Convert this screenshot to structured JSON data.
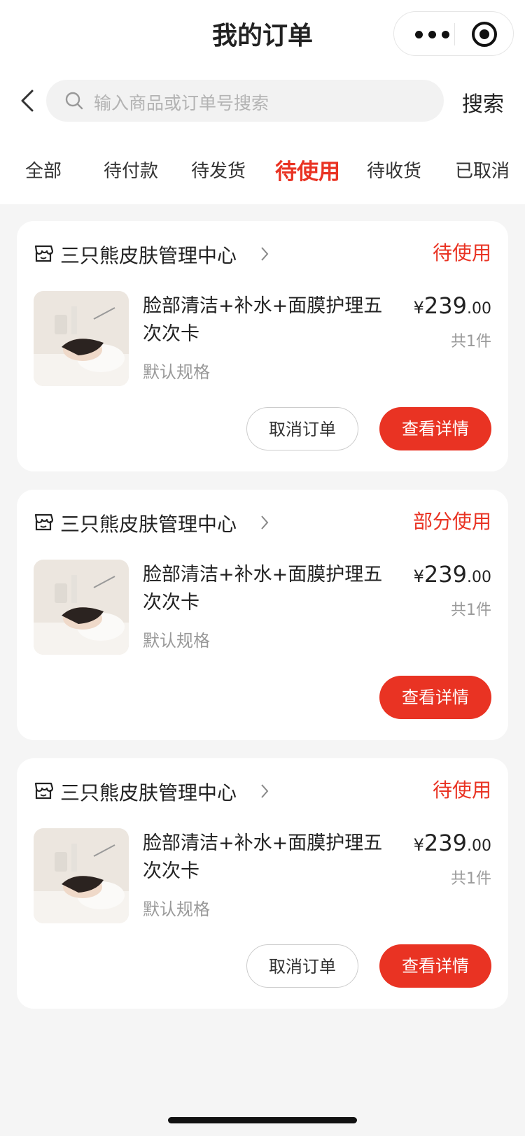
{
  "header": {
    "title": "我的订单",
    "capsule": {
      "more_icon": "more-dots-icon",
      "close_icon": "target-close-icon"
    }
  },
  "search": {
    "placeholder": "输入商品或订单号搜索",
    "button": "搜索"
  },
  "tabs": [
    {
      "label": "全部",
      "active": false
    },
    {
      "label": "待付款",
      "active": false
    },
    {
      "label": "待发货",
      "active": false
    },
    {
      "label": "待使用",
      "active": true
    },
    {
      "label": "待收货",
      "active": false
    },
    {
      "label": "已取消",
      "active": false
    }
  ],
  "colors": {
    "accent": "#e93323",
    "bg": "#f5f5f5"
  },
  "orders": [
    {
      "shop": "三只熊皮肤管理中心",
      "status": "待使用",
      "product": "脸部清洁+补水+面膜护理五次次卡",
      "spec": "默认规格",
      "price_currency": "¥",
      "price_int": "239",
      "price_dec": ".00",
      "qty": "共1件",
      "cancel_label": "取消订单",
      "detail_label": "查看详情"
    },
    {
      "shop": "三只熊皮肤管理中心",
      "status": "部分使用",
      "product": "脸部清洁+补水+面膜护理五次次卡",
      "spec": "默认规格",
      "price_currency": "¥",
      "price_int": "239",
      "price_dec": ".00",
      "qty": "共1件",
      "detail_label": "查看详情"
    },
    {
      "shop": "三只熊皮肤管理中心",
      "status": "待使用",
      "product": "脸部清洁+补水+面膜护理五次次卡",
      "spec": "默认规格",
      "price_currency": "¥",
      "price_int": "239",
      "price_dec": ".00",
      "qty": "共1件",
      "cancel_label": "取消订单",
      "detail_label": "查看详情"
    }
  ]
}
